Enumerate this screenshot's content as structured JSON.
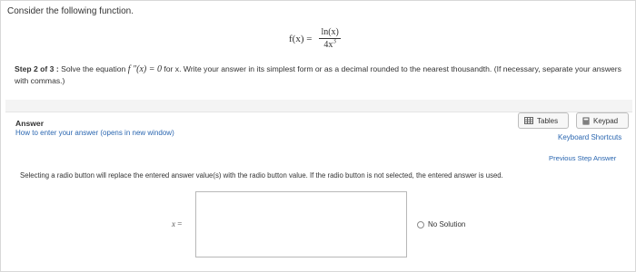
{
  "question": {
    "intro": "Consider the following function.",
    "formula": {
      "lhs": "f(x) =",
      "numerator": "ln(x)",
      "denominator_base": "4x",
      "denominator_exponent": "3"
    }
  },
  "step": {
    "label": "Step 2 of 3 :",
    "text_before_eq": " Solve the equation ",
    "equation": "f ″(x) = 0",
    "text_after_eq": " for x. Write your answer in its simplest form or as a decimal rounded to the nearest thousandth. (If necessary, separate your answers with commas.)"
  },
  "answer": {
    "label": "Answer",
    "howto_link": "How to enter your answer (opens in new window)",
    "tables_button": "Tables",
    "keypad_button": "Keypad",
    "keyboard_shortcuts": "Keyboard Shortcuts",
    "previous_step": "Previous Step Answer",
    "radio_note": "Selecting a radio button will replace the entered answer value(s) with the radio button value. If the radio button is not selected, the entered answer is used.",
    "input_label_var": "x",
    "input_label_eq": "=",
    "input_value": "",
    "no_solution": "No Solution"
  },
  "colors": {
    "link": "#2a66b0",
    "text": "#333333",
    "panel_bg": "#f4f4f4"
  },
  "icons": {
    "tables": "table-grid-icon",
    "keypad": "calculator-icon",
    "radio": "radio-unchecked-icon"
  }
}
